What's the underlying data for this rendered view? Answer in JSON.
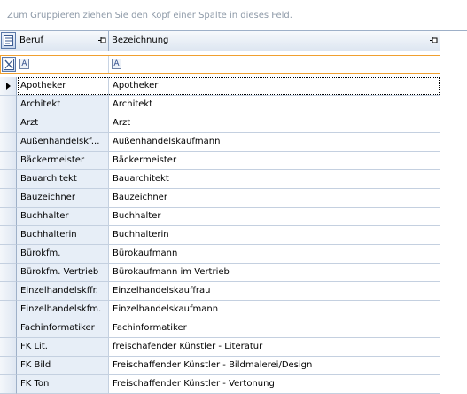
{
  "group_panel": {
    "text": "Zum Gruppieren ziehen Sie den Kopf einer Spalte in dieses Feld."
  },
  "columns": [
    {
      "label": "Beruf"
    },
    {
      "label": "Bezeichnung"
    }
  ],
  "filter": {
    "icon_glyph": "A"
  },
  "rows": [
    {
      "beruf": "Apotheker",
      "bezeichnung": "Apotheker"
    },
    {
      "beruf": "Architekt",
      "bezeichnung": "Architekt"
    },
    {
      "beruf": "Arzt",
      "bezeichnung": "Arzt"
    },
    {
      "beruf": "Außenhandelskf...",
      "bezeichnung": "Außenhandelskaufmann"
    },
    {
      "beruf": "Bäckermeister",
      "bezeichnung": "Bäckermeister"
    },
    {
      "beruf": "Bauarchitekt",
      "bezeichnung": "Bauarchitekt"
    },
    {
      "beruf": "Bauzeichner",
      "bezeichnung": "Bauzeichner"
    },
    {
      "beruf": "Buchhalter",
      "bezeichnung": "Buchhalter"
    },
    {
      "beruf": "Buchhalterin",
      "bezeichnung": "Buchhalterin"
    },
    {
      "beruf": "Bürokfm.",
      "bezeichnung": "Bürokaufmann"
    },
    {
      "beruf": "Bürokfm. Vertrieb",
      "bezeichnung": "Bürokaufmann im Vertrieb"
    },
    {
      "beruf": "Einzelhandelskffr.",
      "bezeichnung": "Einzelhandelskauffrau"
    },
    {
      "beruf": "Einzelhandelskfm.",
      "bezeichnung": "Einzelhandelskaufmann"
    },
    {
      "beruf": "Fachinformatiker",
      "bezeichnung": "Fachinformatiker"
    },
    {
      "beruf": "FK Lit.",
      "bezeichnung": "freischafender Künstler - Literatur"
    },
    {
      "beruf": "FK Bild",
      "bezeichnung": "Freischaffender Künstler - Bildmalerei/Design"
    },
    {
      "beruf": "FK Ton",
      "bezeichnung": "Freischaffender Künstler - Vertonung"
    }
  ]
}
